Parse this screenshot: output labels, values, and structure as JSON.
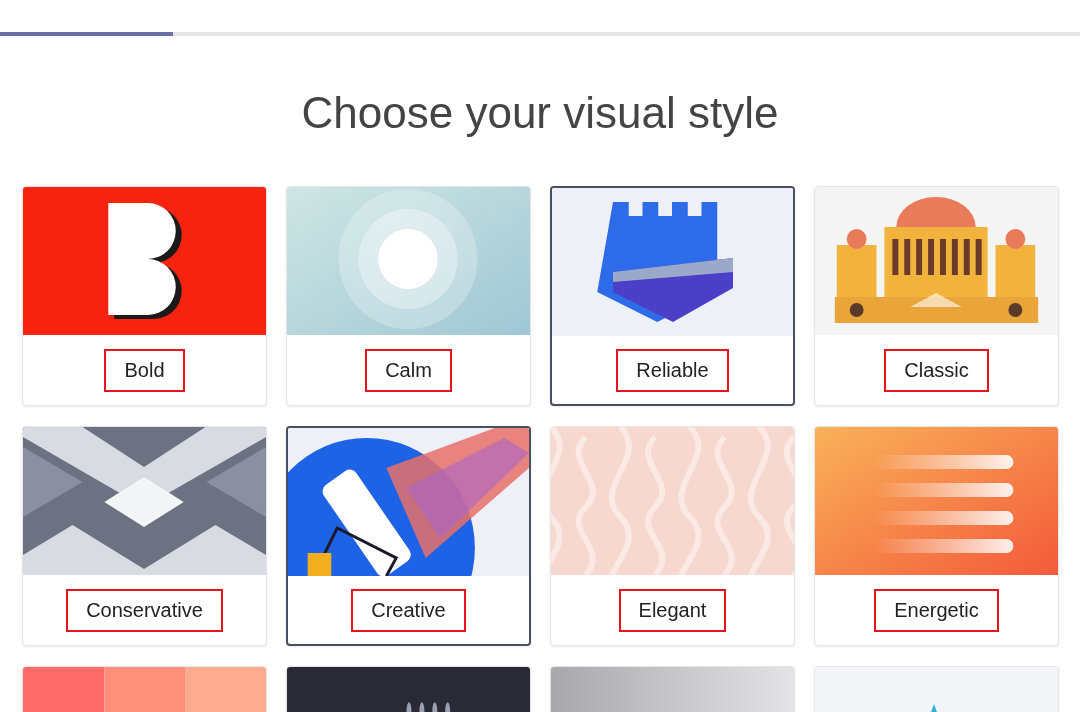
{
  "progress": {
    "level": 0.16
  },
  "heading": "Choose your visual style",
  "cards": [
    {
      "kind": "bold",
      "label": "Bold",
      "selected": false
    },
    {
      "kind": "calm",
      "label": "Calm",
      "selected": false
    },
    {
      "kind": "reliable",
      "label": "Reliable",
      "selected": true
    },
    {
      "kind": "classic",
      "label": "Classic",
      "selected": false
    },
    {
      "kind": "conservative",
      "label": "Conservative",
      "selected": false
    },
    {
      "kind": "creative",
      "label": "Creative",
      "selected": true
    },
    {
      "kind": "elegant",
      "label": "Elegant",
      "selected": false
    },
    {
      "kind": "energetic",
      "label": "Energetic",
      "selected": false
    },
    {
      "kind": "stripes",
      "selected": false
    },
    {
      "kind": "dots",
      "selected": false
    },
    {
      "kind": "gray",
      "selected": false
    },
    {
      "kind": "geo",
      "selected": false
    }
  ]
}
